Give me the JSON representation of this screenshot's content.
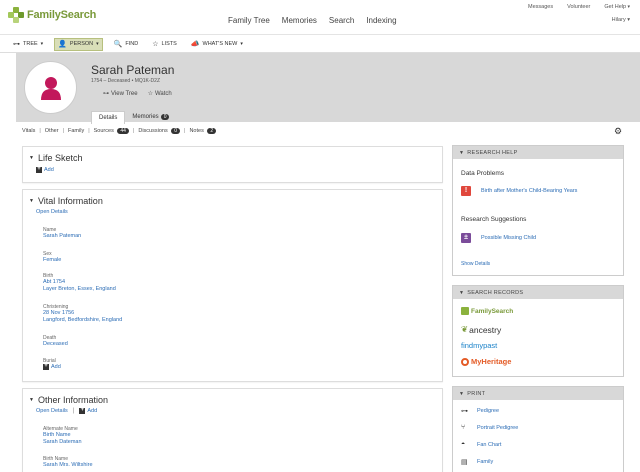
{
  "header": {
    "logo_text": "FamilySearch",
    "nav": [
      "Family Tree",
      "Memories",
      "Search",
      "Indexing"
    ],
    "utility": {
      "messages": "Messages",
      "volunteer": "Volunteer",
      "help": "Get Help"
    },
    "user": "Hilary"
  },
  "toolbar": {
    "tree": "TREE",
    "person": "PERSON",
    "find": "FIND",
    "lists": "LISTS",
    "whats_new": "WHAT'S NEW"
  },
  "person": {
    "name": "Sarah Pateman",
    "lifespan": "1754 – Deceased • MQ1K-D2Z",
    "view_tree": "View Tree",
    "watch": "Watch",
    "tabs": [
      {
        "label": "Details"
      },
      {
        "label": "Memories",
        "count": "0"
      }
    ]
  },
  "filters": {
    "vitals": "Vitals",
    "other": "Other",
    "family": "Family",
    "sources": "Sources",
    "sources_count": "44",
    "discussions": "Discussions",
    "discussions_count": "0",
    "notes": "Notes",
    "notes_count": "2"
  },
  "life_sketch": {
    "title": "Life Sketch",
    "add": "Add"
  },
  "vital": {
    "title": "Vital Information",
    "open_details": "Open Details",
    "name_label": "Name",
    "name_value": "Sarah Pateman",
    "sex_label": "Sex",
    "sex_value": "Female",
    "birth_label": "Birth",
    "birth_date": "Abt 1754",
    "birth_place": "Layer Breton, Essex, England",
    "christening_label": "Christening",
    "christening_date": "28 Nov 1756",
    "christening_place": "Langford, Bedfordshire, England",
    "death_label": "Death",
    "death_value": "Deceased",
    "burial_label": "Burial",
    "burial_add": "Add"
  },
  "other_info": {
    "title": "Other Information",
    "open_details": "Open Details",
    "add": "Add",
    "alt_name_label": "Alternate Name",
    "alt_name_1": "Birth Name",
    "alt_name_1_value": "Sarah Dateman",
    "alt_name_2": "Birth Name",
    "alt_name_2_value": "Sarah Mrs. Wiltshire"
  },
  "research_help": {
    "title": "RESEARCH HELP",
    "data_problems": "Data Problems",
    "problem_1": "Birth after Mother's Child-Bearing Years",
    "suggestions": "Research Suggestions",
    "suggestion_1": "Possible Missing Child",
    "show_details": "Show Details"
  },
  "search_records": {
    "title": "SEARCH RECORDS",
    "sites": [
      "FamilySearch",
      "ancestry",
      "findmypast",
      "MyHeritage"
    ]
  },
  "print": {
    "title": "PRINT",
    "items": [
      "Pedigree",
      "Portrait Pedigree",
      "Fan Chart",
      "Family"
    ]
  },
  "colors": {
    "link": "#2b6cb5",
    "avatar_female": "#c2185b",
    "problem_red": "#e0473c",
    "suggestion_purple": "#7b4c9a",
    "header_gray": "#d8d8d8"
  }
}
